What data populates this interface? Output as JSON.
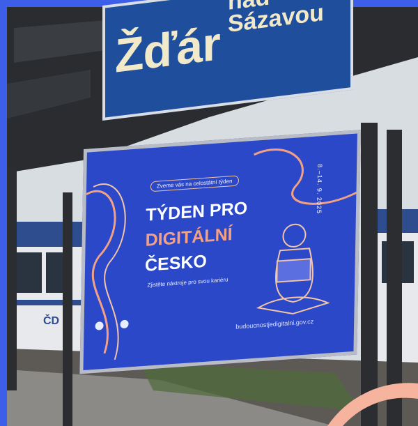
{
  "station_sign": {
    "city": "Žďár",
    "nad": "nad",
    "river": "Sázavou"
  },
  "billboard": {
    "event_pill": "Zveme vás na celostátní týden",
    "headline_line1": "TÝDEN PRO",
    "headline_line2": "DIGITÁLNÍ",
    "headline_line3": "ČESKO",
    "tagline": "Zjistěte nástroje pro svou kariéru",
    "dates": "8.–14. 9. 2025",
    "url": "budoucnostjedigitalni.gov.cz"
  },
  "train_logo": "ČD",
  "colors": {
    "frame_accent": "#3d5ee8",
    "billboard_blue": "#2b48c9",
    "sign_blue": "#1f4f9c",
    "headline_orange": "#f3a184",
    "corner_peach": "#f6b39e"
  }
}
